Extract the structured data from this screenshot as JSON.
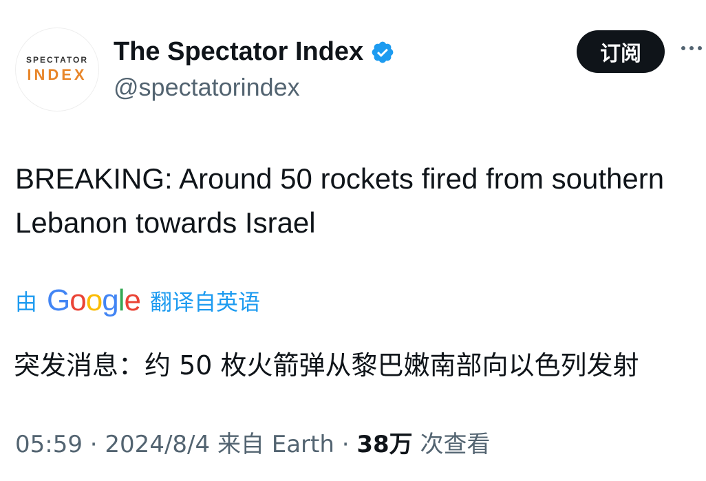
{
  "author": {
    "avatar_top": "SPECTATOR",
    "avatar_bottom": "INDEX",
    "name": "The Spectator Index",
    "handle": "@spectatorindex"
  },
  "actions": {
    "subscribe_label": "订阅"
  },
  "tweet": {
    "text": "BREAKING: Around 50 rockets fired from southern Lebanon towards Israel"
  },
  "translation": {
    "prefix": "由",
    "provider": "Google",
    "suffix": "翻译自英语",
    "text": "突发消息：约 50 枚火箭弹从黎巴嫩南部向以色列发射"
  },
  "meta": {
    "time": "05:59",
    "date": "2024/8/4",
    "source": "来自 Earth",
    "views": "38万",
    "views_label": "次查看"
  },
  "colors": {
    "accent": "#1d9bf0",
    "avatar_accent": "#e8862a"
  }
}
